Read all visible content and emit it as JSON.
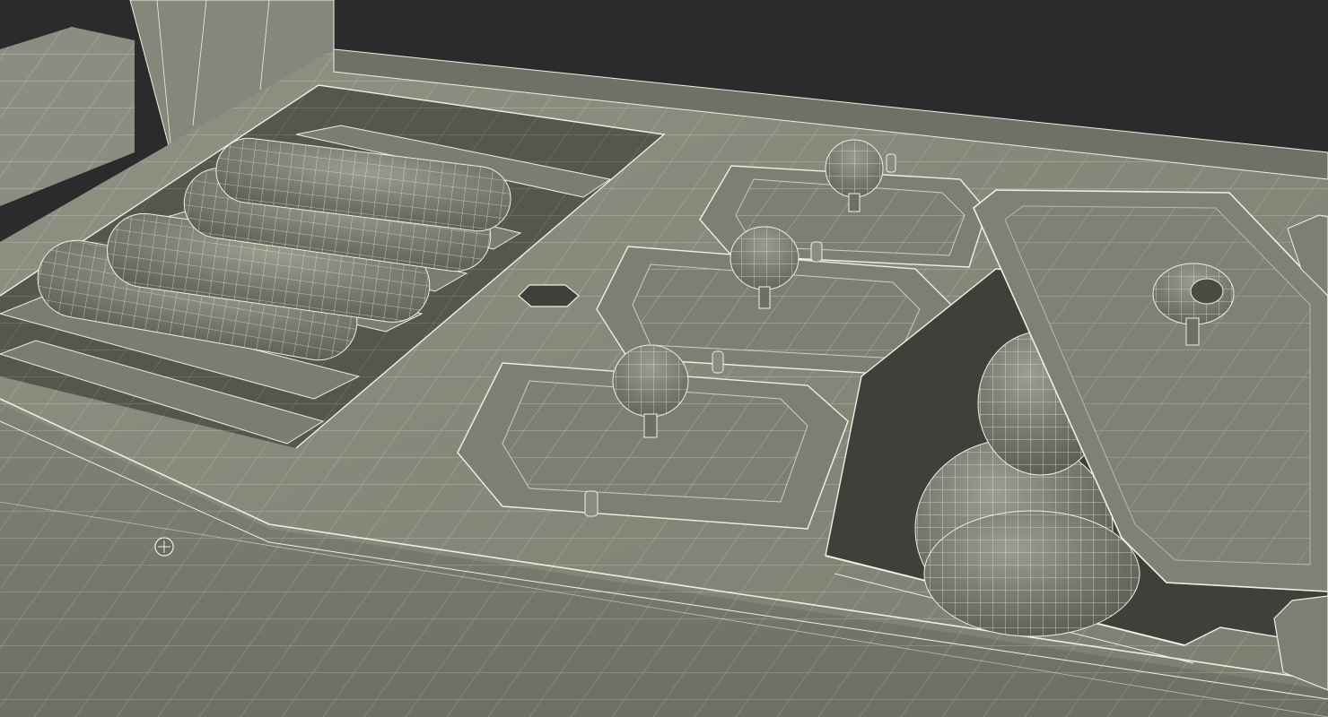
{
  "render": {
    "style": "wireframe-over-clay",
    "colors": {
      "background": "#2b2b2b",
      "clay_light": "#8c8e80",
      "clay_mid": "#7a7c6f",
      "clay_dark": "#5c5e54",
      "clay_shadow": "#3e403a",
      "wire": "#eef0e4"
    }
  },
  "objects": [
    "grill-tray",
    "sausage-rack",
    "sausage",
    "round-lid",
    "lid-knob",
    "open-lid",
    "lid-hinge",
    "bread-roll",
    "vent-hole",
    "back-panel"
  ]
}
